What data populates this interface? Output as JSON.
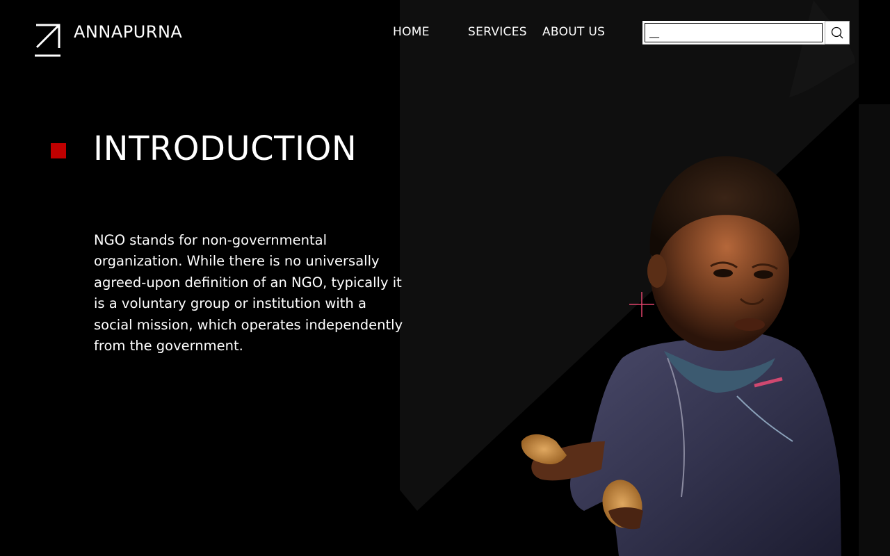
{
  "brand": {
    "name": "ANNAPURNA",
    "logo_icon": "arrow-up-right-icon"
  },
  "nav": {
    "items": [
      {
        "label": "HOME"
      },
      {
        "label": "SERVICES"
      },
      {
        "label": "ABOUT US"
      }
    ]
  },
  "search": {
    "placeholder": "__",
    "icon": "search-icon"
  },
  "section": {
    "title": "INTRODUCTION",
    "body": "NGO stands for non-governmental organization. While there is no universally agreed-upon definition of an NGO, typically it is a voluntary group or institution with a social mission, which operates independently from the government."
  },
  "colors": {
    "background": "#000000",
    "accent": "#c00000",
    "crosshair": "#e0436b",
    "text": "#ffffff"
  }
}
